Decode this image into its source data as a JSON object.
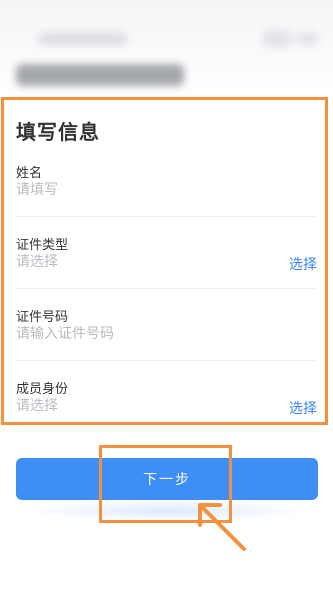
{
  "form": {
    "title": "填写信息",
    "fields": [
      {
        "label": "姓名",
        "placeholder": "请填写",
        "action": ""
      },
      {
        "label": "证件类型",
        "placeholder": "请选择",
        "action": "选择"
      },
      {
        "label": "证件号码",
        "placeholder": "请输入证件号码",
        "action": ""
      },
      {
        "label": "成员身份",
        "placeholder": "请选择",
        "action": "选择"
      }
    ]
  },
  "next_button": {
    "label": "下一步"
  },
  "colors": {
    "accent": "#3d8ef5",
    "link": "#3a86f4",
    "annotation": "#f3913f",
    "placeholder": "#b9bbc0",
    "text": "#333333"
  }
}
